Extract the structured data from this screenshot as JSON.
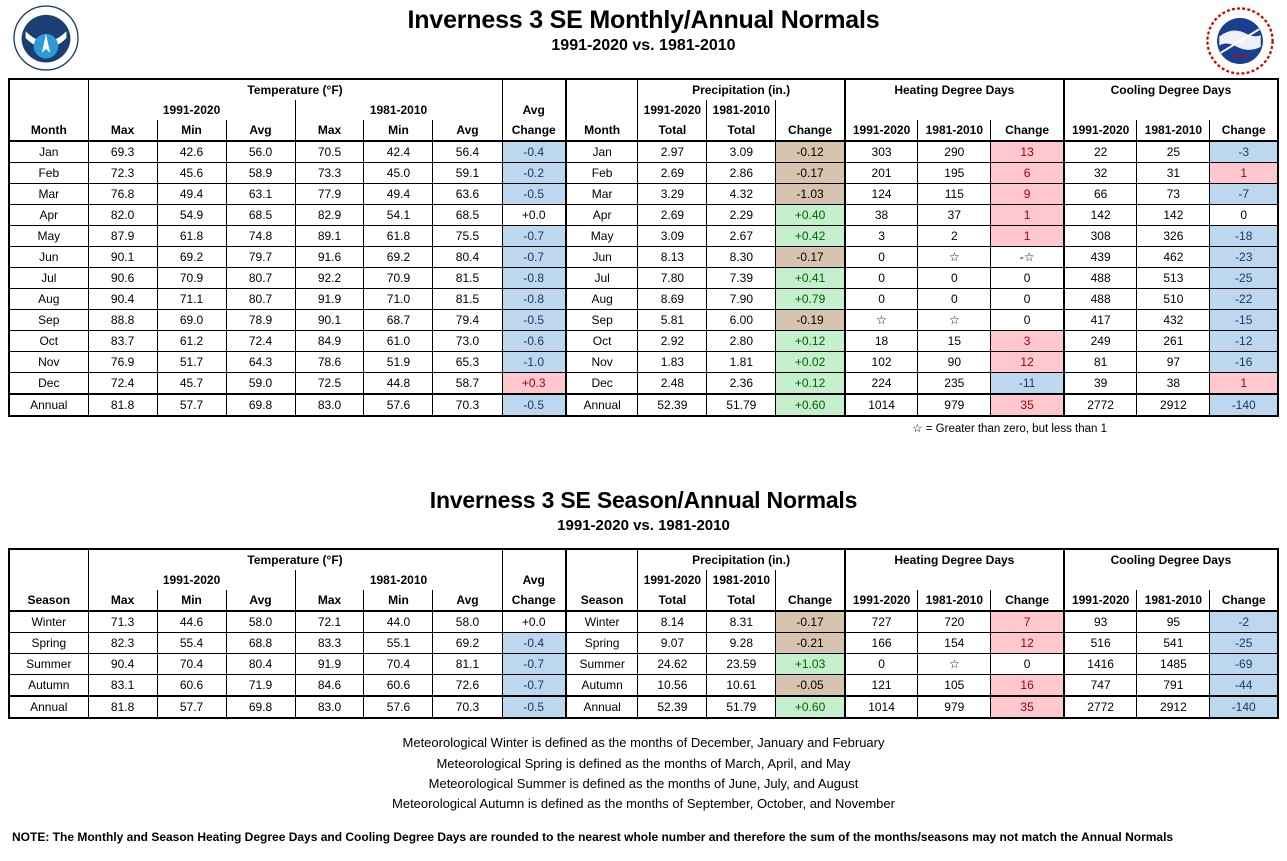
{
  "header": {
    "logo_left": "noaa-logo",
    "logo_right": "national-weather-service-logo",
    "title": "Inverness 3 SE Monthly/Annual Normals",
    "subtitle": "1991-2020 vs. 1981-2010"
  },
  "section2": {
    "title": "Inverness 3 SE Season/Annual Normals",
    "subtitle": "1991-2020 vs. 1981-2010"
  },
  "groups": {
    "temperature": "Temperature (°F)",
    "precipitation": "Precipitation (in.)",
    "heating": "Heating Degree Days",
    "cooling": "Cooling Degree Days"
  },
  "periods": {
    "new": "1991-2020",
    "old": "1981-2010"
  },
  "columns": {
    "month": "Month",
    "season": "Season",
    "max": "Max",
    "min": "Min",
    "avg": "Avg",
    "avg_change_l1": "Avg",
    "avg_change_l2": "Change",
    "total": "Total",
    "change": "Change"
  },
  "footnote_star": "☆ = Greater than zero, but less than 1",
  "season_definitions": [
    "Meteorological Winter is defined as the months of December, January and February",
    "Meteorological Spring is defined as the months of March, April, and May",
    "Meteorological Summer is defined as the months of June, July, and August",
    "Meteorological Autumn is defined as the months of September, October, and November"
  ],
  "final_note": "NOTE:  The Monthly and Season Heating Degree Days and Cooling Degree Days are rounded to the nearest whole number and therefore the sum of the months/seasons may not match the Annual Normals",
  "colors": {
    "blue": "#bdd7ee",
    "blue_text": "#1f3864",
    "pink": "#ffc7ce",
    "pink_text": "#9c0006",
    "green": "#c6efce",
    "green_text": "#006100",
    "tan": "#d7c4ae",
    "noaa_blue": "#1b75bb",
    "nws_red": "#cc0000"
  },
  "chart_data": {
    "type": "table",
    "title": "Inverness 3 SE Monthly/Annual and Season/Annual Normals, 1991-2020 vs. 1981-2010",
    "monthly": {
      "row_labels": [
        "Jan",
        "Feb",
        "Mar",
        "Apr",
        "May",
        "Jun",
        "Jul",
        "Aug",
        "Sep",
        "Oct",
        "Nov",
        "Dec",
        "Annual"
      ],
      "temp_new_max": [
        "69.3",
        "72.3",
        "76.8",
        "82.0",
        "87.9",
        "90.1",
        "90.6",
        "90.4",
        "88.8",
        "83.7",
        "76.9",
        "72.4",
        "81.8"
      ],
      "temp_new_min": [
        "42.6",
        "45.6",
        "49.4",
        "54.9",
        "61.8",
        "69.2",
        "70.9",
        "71.1",
        "69.0",
        "61.2",
        "51.7",
        "45.7",
        "57.7"
      ],
      "temp_new_avg": [
        "56.0",
        "58.9",
        "63.1",
        "68.5",
        "74.8",
        "79.7",
        "80.7",
        "80.7",
        "78.9",
        "72.4",
        "64.3",
        "59.0",
        "69.8"
      ],
      "temp_old_max": [
        "70.5",
        "73.3",
        "77.9",
        "82.9",
        "89.1",
        "91.6",
        "92.2",
        "91.9",
        "90.1",
        "84.9",
        "78.6",
        "72.5",
        "83.0"
      ],
      "temp_old_min": [
        "42.4",
        "45.0",
        "49.4",
        "54.1",
        "61.8",
        "69.2",
        "70.9",
        "71.0",
        "68.7",
        "61.0",
        "51.9",
        "44.8",
        "57.6"
      ],
      "temp_old_avg": [
        "56.4",
        "59.1",
        "63.6",
        "68.5",
        "75.5",
        "80.4",
        "81.5",
        "81.5",
        "79.4",
        "73.0",
        "65.3",
        "58.7",
        "70.3"
      ],
      "temp_avg_change": [
        "-0.4",
        "-0.2",
        "-0.5",
        "+0.0",
        "-0.7",
        "-0.7",
        "-0.8",
        "-0.8",
        "-0.5",
        "-0.6",
        "-1.0",
        "+0.3",
        "-0.5"
      ],
      "temp_avg_change_hl": [
        "blue",
        "blue",
        "blue",
        "none",
        "blue",
        "blue",
        "blue",
        "blue",
        "blue",
        "blue",
        "blue",
        "pink",
        "blue"
      ],
      "precip_new": [
        "2.97",
        "2.69",
        "3.29",
        "2.69",
        "3.09",
        "8.13",
        "7.80",
        "8.69",
        "5.81",
        "2.92",
        "1.83",
        "2.48",
        "52.39"
      ],
      "precip_old": [
        "3.09",
        "2.86",
        "4.32",
        "2.29",
        "2.67",
        "8.30",
        "7.39",
        "7.90",
        "6.00",
        "2.80",
        "1.81",
        "2.36",
        "51.79"
      ],
      "precip_change": [
        "-0.12",
        "-0.17",
        "-1.03",
        "+0.40",
        "+0.42",
        "-0.17",
        "+0.41",
        "+0.79",
        "-0.19",
        "+0.12",
        "+0.02",
        "+0.12",
        "+0.60"
      ],
      "precip_change_hl": [
        "tan",
        "tan",
        "tan",
        "green",
        "green",
        "tan",
        "green",
        "green",
        "tan",
        "green",
        "green",
        "green",
        "green"
      ],
      "hdd_new": [
        "303",
        "201",
        "124",
        "38",
        "3",
        "0",
        "0",
        "0",
        "☆",
        "18",
        "102",
        "224",
        "1014"
      ],
      "hdd_old": [
        "290",
        "195",
        "115",
        "37",
        "2",
        "☆",
        "0",
        "0",
        "☆",
        "15",
        "90",
        "235",
        "979"
      ],
      "hdd_change": [
        "13",
        "6",
        "9",
        "1",
        "1",
        "-☆",
        "0",
        "0",
        "0",
        "3",
        "12",
        "-11",
        "35"
      ],
      "hdd_change_hl": [
        "pink",
        "pink",
        "pink",
        "pink",
        "pink",
        "none",
        "none",
        "none",
        "none",
        "pink",
        "pink",
        "blue",
        "pink"
      ],
      "cdd_new": [
        "22",
        "32",
        "66",
        "142",
        "308",
        "439",
        "488",
        "488",
        "417",
        "249",
        "81",
        "39",
        "2772"
      ],
      "cdd_old": [
        "25",
        "31",
        "73",
        "142",
        "326",
        "462",
        "513",
        "510",
        "432",
        "261",
        "97",
        "38",
        "2912"
      ],
      "cdd_change": [
        "-3",
        "1",
        "-7",
        "0",
        "-18",
        "-23",
        "-25",
        "-22",
        "-15",
        "-12",
        "-16",
        "1",
        "-140"
      ],
      "cdd_change_hl": [
        "blue",
        "pink",
        "blue",
        "none",
        "blue",
        "blue",
        "blue",
        "blue",
        "blue",
        "blue",
        "blue",
        "pink",
        "blue"
      ]
    },
    "seasonal": {
      "row_labels": [
        "Winter",
        "Spring",
        "Summer",
        "Autumn",
        "Annual"
      ],
      "temp_new_max": [
        "71.3",
        "82.3",
        "90.4",
        "83.1",
        "81.8"
      ],
      "temp_new_min": [
        "44.6",
        "55.4",
        "70.4",
        "60.6",
        "57.7"
      ],
      "temp_new_avg": [
        "58.0",
        "68.8",
        "80.4",
        "71.9",
        "69.8"
      ],
      "temp_old_max": [
        "72.1",
        "83.3",
        "91.9",
        "84.6",
        "83.0"
      ],
      "temp_old_min": [
        "44.0",
        "55.1",
        "70.4",
        "60.6",
        "57.6"
      ],
      "temp_old_avg": [
        "58.0",
        "69.2",
        "81.1",
        "72.6",
        "70.3"
      ],
      "temp_avg_change": [
        "+0.0",
        "-0.4",
        "-0.7",
        "-0.7",
        "-0.5"
      ],
      "temp_avg_change_hl": [
        "none",
        "blue",
        "blue",
        "blue",
        "blue"
      ],
      "precip_new": [
        "8.14",
        "9.07",
        "24.62",
        "10.56",
        "52.39"
      ],
      "precip_old": [
        "8.31",
        "9.28",
        "23.59",
        "10.61",
        "51.79"
      ],
      "precip_change": [
        "-0.17",
        "-0.21",
        "+1.03",
        "-0.05",
        "+0.60"
      ],
      "precip_change_hl": [
        "tan",
        "tan",
        "green",
        "tan",
        "green"
      ],
      "hdd_new": [
        "727",
        "166",
        "0",
        "121",
        "1014"
      ],
      "hdd_old": [
        "720",
        "154",
        "☆",
        "105",
        "979"
      ],
      "hdd_change": [
        "7",
        "12",
        "0",
        "16",
        "35"
      ],
      "hdd_change_hl": [
        "pink",
        "pink",
        "none",
        "pink",
        "pink"
      ],
      "cdd_new": [
        "93",
        "516",
        "1416",
        "747",
        "2772"
      ],
      "cdd_old": [
        "95",
        "541",
        "1485",
        "791",
        "2912"
      ],
      "cdd_change": [
        "-2",
        "-25",
        "-69",
        "-44",
        "-140"
      ],
      "cdd_change_hl": [
        "blue",
        "blue",
        "blue",
        "blue",
        "blue"
      ]
    }
  }
}
